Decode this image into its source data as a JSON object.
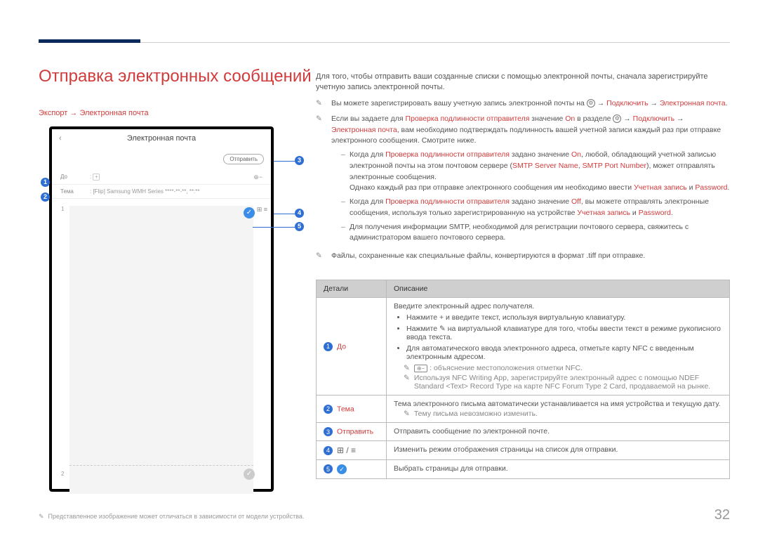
{
  "page": {
    "title": "Отправка электронных сообщений",
    "breadcrumb": "Экспорт → Электронная почта",
    "intro": "Для того, чтобы отправить ваши созданные списки с помощью электронной почты, сначала зарегистрируйте учетную запись электронной почты.",
    "page_number": "32",
    "footnote": "Представленное изображение может отличаться в зависимости от модели устройства."
  },
  "screenshot": {
    "header": "Электронная почта",
    "send_button": "Отправить",
    "to_label": "До",
    "subject_label": "Тема",
    "subject_value": "[Flip] Samsung WMH Series ****-**-**, **:**",
    "page1": "1",
    "page2": "2"
  },
  "callouts": [
    "1",
    "2",
    "3",
    "4",
    "5"
  ],
  "notes": [
    {
      "text_parts": [
        {
          "t": "Вы можете зарегистрировать вашу учетную запись электронной почты на "
        },
        {
          "gear": true
        },
        {
          "t": " → "
        },
        {
          "t": "Подключить",
          "red": true
        },
        {
          "t": " → "
        },
        {
          "t": "Электронная почта",
          "red": true
        },
        {
          "t": "."
        }
      ]
    },
    {
      "text_parts": [
        {
          "t": "Если вы задаете для "
        },
        {
          "t": "Проверка подлинности отправителя",
          "red": true
        },
        {
          "t": " значение "
        },
        {
          "t": "On",
          "red": true
        },
        {
          "t": " в разделе "
        },
        {
          "gear": true
        },
        {
          "t": " → "
        },
        {
          "t": "Подключить",
          "red": true
        },
        {
          "t": " → "
        },
        {
          "t": "Электронная почта",
          "red": true
        },
        {
          "t": ", вам необходимо подтверждать подлинность вашей учетной записи каждый раз при отправке электронного сообщения. Смотрите ниже."
        }
      ],
      "subs": [
        [
          {
            "t": "Когда для "
          },
          {
            "t": "Проверка подлинности отправителя",
            "red": true
          },
          {
            "t": " задано значение "
          },
          {
            "t": "On",
            "red": true
          },
          {
            "t": ", любой, обладающий учетной записью электронной почты на этом почтовом сервере ("
          },
          {
            "t": "SMTP Server Name",
            "red": true
          },
          {
            "t": ", "
          },
          {
            "t": "SMTP Port Number",
            "red": true
          },
          {
            "t": "), может отправлять электронные сообщения."
          },
          {
            "br": true
          },
          {
            "t": "Однако каждый раз при отправке электронного сообщения им необходимо ввести "
          },
          {
            "t": "Учетная запись",
            "red": true
          },
          {
            "t": " и "
          },
          {
            "t": "Password",
            "red": true
          },
          {
            "t": "."
          }
        ],
        [
          {
            "t": "Когда для "
          },
          {
            "t": "Проверка подлинности отправителя",
            "red": true
          },
          {
            "t": " задано значение "
          },
          {
            "t": "Off",
            "red": true
          },
          {
            "t": ", вы можете отправлять электронные сообщения, используя только зарегистрированную на устройстве "
          },
          {
            "t": "Учетная запись",
            "red": true
          },
          {
            "t": " и "
          },
          {
            "t": "Password",
            "red": true
          },
          {
            "t": "."
          }
        ],
        [
          {
            "t": "Для получения информации SMTP, необходимой для регистрации почтового сервера, свяжитесь с администратором вашего почтового сервера."
          }
        ]
      ]
    },
    {
      "text_parts": [
        {
          "t": "Файлы, сохраненные как специальные файлы, конвертируются в формат .tiff при отправке."
        }
      ]
    }
  ],
  "table": {
    "head": {
      "c1": "Детали",
      "c2": "Описание"
    },
    "rows": [
      {
        "num": "1",
        "label": "До",
        "desc": {
          "intro": "Введите электронный адрес получателя.",
          "bullets": [
            "Нажмите + и введите текст, используя виртуальную клавиатуру.",
            "Нажмите ✎ на виртуальной клавиатуре для того, чтобы ввести текст в режиме рукописного ввода текста.",
            "Для автоматического ввода электронного адреса, отметьте карту NFC с введенным электронным адресом."
          ],
          "sub_notes": [
            {
              "icon": "✎",
              "nfc_box": "⊕−",
              "text": ": объяснение местоположения отметки NFC."
            },
            {
              "icon": "✎",
              "gray_parts": [
                {
                  "t": "Используя "
                },
                {
                  "t": "NFC Writing App",
                  "bold": true
                },
                {
                  "t": ", зарегистрируйте электронный адрес с помощью "
                },
                {
                  "t": "NDEF Standard <Text> Record Type",
                  "bold": true
                },
                {
                  "t": " на карте "
                },
                {
                  "t": "NFC Forum Type 2 Card",
                  "bold": true
                },
                {
                  "t": ", продаваемой на рынке."
                }
              ]
            }
          ]
        }
      },
      {
        "num": "2",
        "label": "Тема",
        "desc": {
          "intro": "Тема электронного письма автоматически устанавливается на имя устройства и текущую дату.",
          "sub_notes": [
            {
              "icon": "✎",
              "text": "Тему письма невозможно изменить.",
              "gray": true
            }
          ]
        }
      },
      {
        "num": "3",
        "label": "Отправить",
        "desc": {
          "intro": "Отправить сообщение по электронной почте."
        }
      },
      {
        "num": "4",
        "view_icons": true,
        "desc": {
          "intro": "Изменить режим отображения страницы на список для отправки."
        }
      },
      {
        "num": "5",
        "check_icon": true,
        "desc": {
          "intro": "Выбрать страницы для отправки."
        }
      }
    ]
  }
}
